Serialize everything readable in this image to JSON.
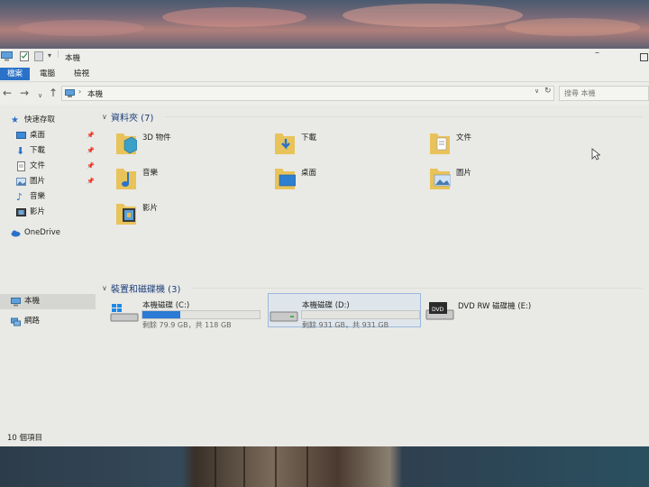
{
  "window": {
    "title": "本機"
  },
  "ribbon": {
    "tabs": [
      "檔案",
      "電腦",
      "檢視"
    ]
  },
  "address": {
    "path": "本機",
    "search_placeholder": "搜尋 本機"
  },
  "sidebar": {
    "quick_access": "快速存取",
    "quick_items": [
      {
        "label": "桌面",
        "icon": "desktop-icon"
      },
      {
        "label": "下載",
        "icon": "download-icon"
      },
      {
        "label": "文件",
        "icon": "document-icon"
      },
      {
        "label": "圖片",
        "icon": "picture-icon"
      },
      {
        "label": "音樂",
        "icon": "music-icon"
      },
      {
        "label": "影片",
        "icon": "video-icon"
      }
    ],
    "onedrive": "OneDrive",
    "this_pc": "本機",
    "network": "網路"
  },
  "folders_group": {
    "title": "資料夾 (7)"
  },
  "folders": [
    "3D 物件",
    "下載",
    "文件",
    "音樂",
    "桌面",
    "圖片",
    "影片"
  ],
  "devices_group": {
    "title": "裝置和磁碟機 (3)"
  },
  "drives": [
    {
      "name": "本機磁碟 (C:)",
      "space": "剩餘 79.9 GB，共 118 GB",
      "used_fraction": 0.323
    },
    {
      "name": "本機磁碟 (D:)",
      "space": "剩餘 931 GB，共 931 GB",
      "used_fraction": 0.0
    },
    {
      "name": "DVD RW 磁碟機 (E:)"
    }
  ],
  "status": {
    "item_count": "10 個項目"
  },
  "colors": {
    "accent": "#2a72c8",
    "drive_fill": "#2a7ad6",
    "folder_yellow": "#e8c35a",
    "group_header": "#1d3f7a"
  }
}
